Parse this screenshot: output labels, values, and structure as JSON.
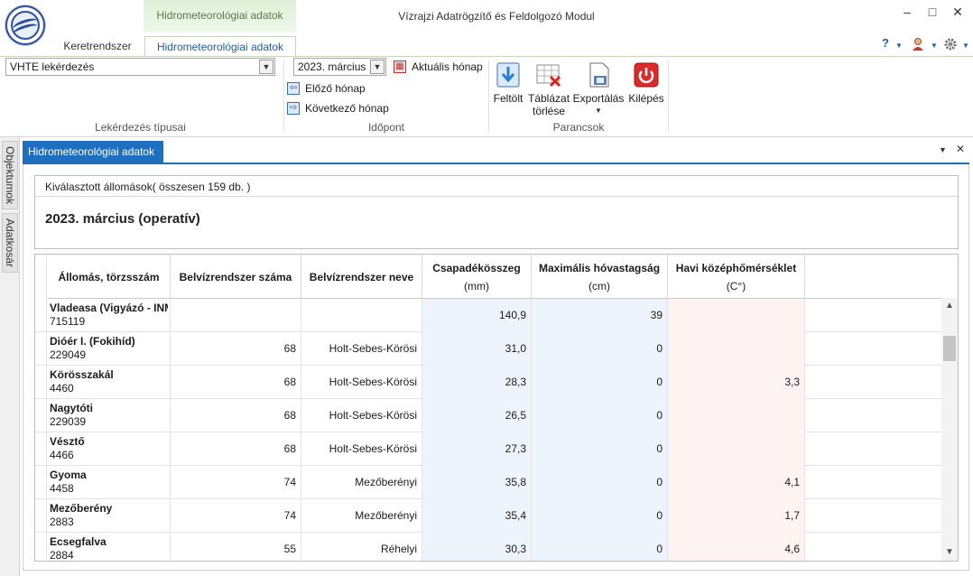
{
  "window": {
    "title": "Vízrajzi Adatrögzítő és Feldolgozó Modul",
    "context_tab_header": "Hidrometeorológiai adatok",
    "minimize": "–",
    "maximize": "□",
    "close": "✕"
  },
  "ribbon": {
    "tabs": [
      "Keretrendszer",
      "Hidrometeorológiai adatok"
    ],
    "help_icon": "?",
    "query_select": "VHTE lekérdezés",
    "query_group_label": "Lekérdezés típusai",
    "month_select": "2023. március",
    "current_month": "Aktuális hónap",
    "prev_month": "Előző hónap",
    "next_month": "Következő hónap",
    "time_group_label": "Időpont",
    "commands": {
      "upload": "Feltölt",
      "clear_line1": "Táblázat",
      "clear_line2": "törlése",
      "export": "Exportálás",
      "exit": "Kilépés"
    },
    "commands_group_label": "Parancsok"
  },
  "side_tabs": [
    "Objektumok",
    "Adatkosár"
  ],
  "document": {
    "tab_label": "Hidrometeorológiai adatok",
    "selected_stations": "Kiválasztott állomások( összesen 159 db. )",
    "heading": "2023. március (operatív)"
  },
  "table": {
    "headers": [
      {
        "l1": "Állomás, törzsszám",
        "l2": ""
      },
      {
        "l1": "Belvízrendszer száma",
        "l2": ""
      },
      {
        "l1": "Belvízrendszer neve",
        "l2": ""
      },
      {
        "l1": "Csapadékösszeg",
        "l2": "(mm)"
      },
      {
        "l1": "Maximális hóvastagság",
        "l2": "(cm)"
      },
      {
        "l1": "Havi középhőmérséklet",
        "l2": "(C°)"
      }
    ],
    "rows": [
      {
        "name": "Vladeasa (Vigyázó - INM",
        "code": "715119",
        "sys_no": "",
        "sys_name": "",
        "precip": "140,9",
        "snow": "39",
        "temp": ""
      },
      {
        "name": "Dióér I. (Fokihíd)",
        "code": "229049",
        "sys_no": "68",
        "sys_name": "Holt-Sebes-Körösi",
        "precip": "31,0",
        "snow": "0",
        "temp": ""
      },
      {
        "name": "Körösszakál",
        "code": "4460",
        "sys_no": "68",
        "sys_name": "Holt-Sebes-Körösi",
        "precip": "28,3",
        "snow": "0",
        "temp": "3,3"
      },
      {
        "name": "Nagytóti",
        "code": "229039",
        "sys_no": "68",
        "sys_name": "Holt-Sebes-Körösi",
        "precip": "26,5",
        "snow": "0",
        "temp": ""
      },
      {
        "name": "Vésztő",
        "code": "4466",
        "sys_no": "68",
        "sys_name": "Holt-Sebes-Körösi",
        "precip": "27,3",
        "snow": "0",
        "temp": ""
      },
      {
        "name": "Gyoma",
        "code": "4458",
        "sys_no": "74",
        "sys_name": "Mezőberényi",
        "precip": "35,8",
        "snow": "0",
        "temp": "4,1"
      },
      {
        "name": "Mezőberény",
        "code": "2883",
        "sys_no": "74",
        "sys_name": "Mezőberényi",
        "precip": "35,4",
        "snow": "0",
        "temp": "1,7"
      },
      {
        "name": "Ecsegfalva",
        "code": "2884",
        "sys_no": "55",
        "sys_name": "Réhelyi",
        "precip": "30,3",
        "snow": "0",
        "temp": "4,6"
      }
    ]
  },
  "colors": {
    "accent": "#1f6fc0",
    "precip_bg": "#eef4fc",
    "temp_bg": "#fdf3f3",
    "context_tab": "#dff0d8"
  }
}
